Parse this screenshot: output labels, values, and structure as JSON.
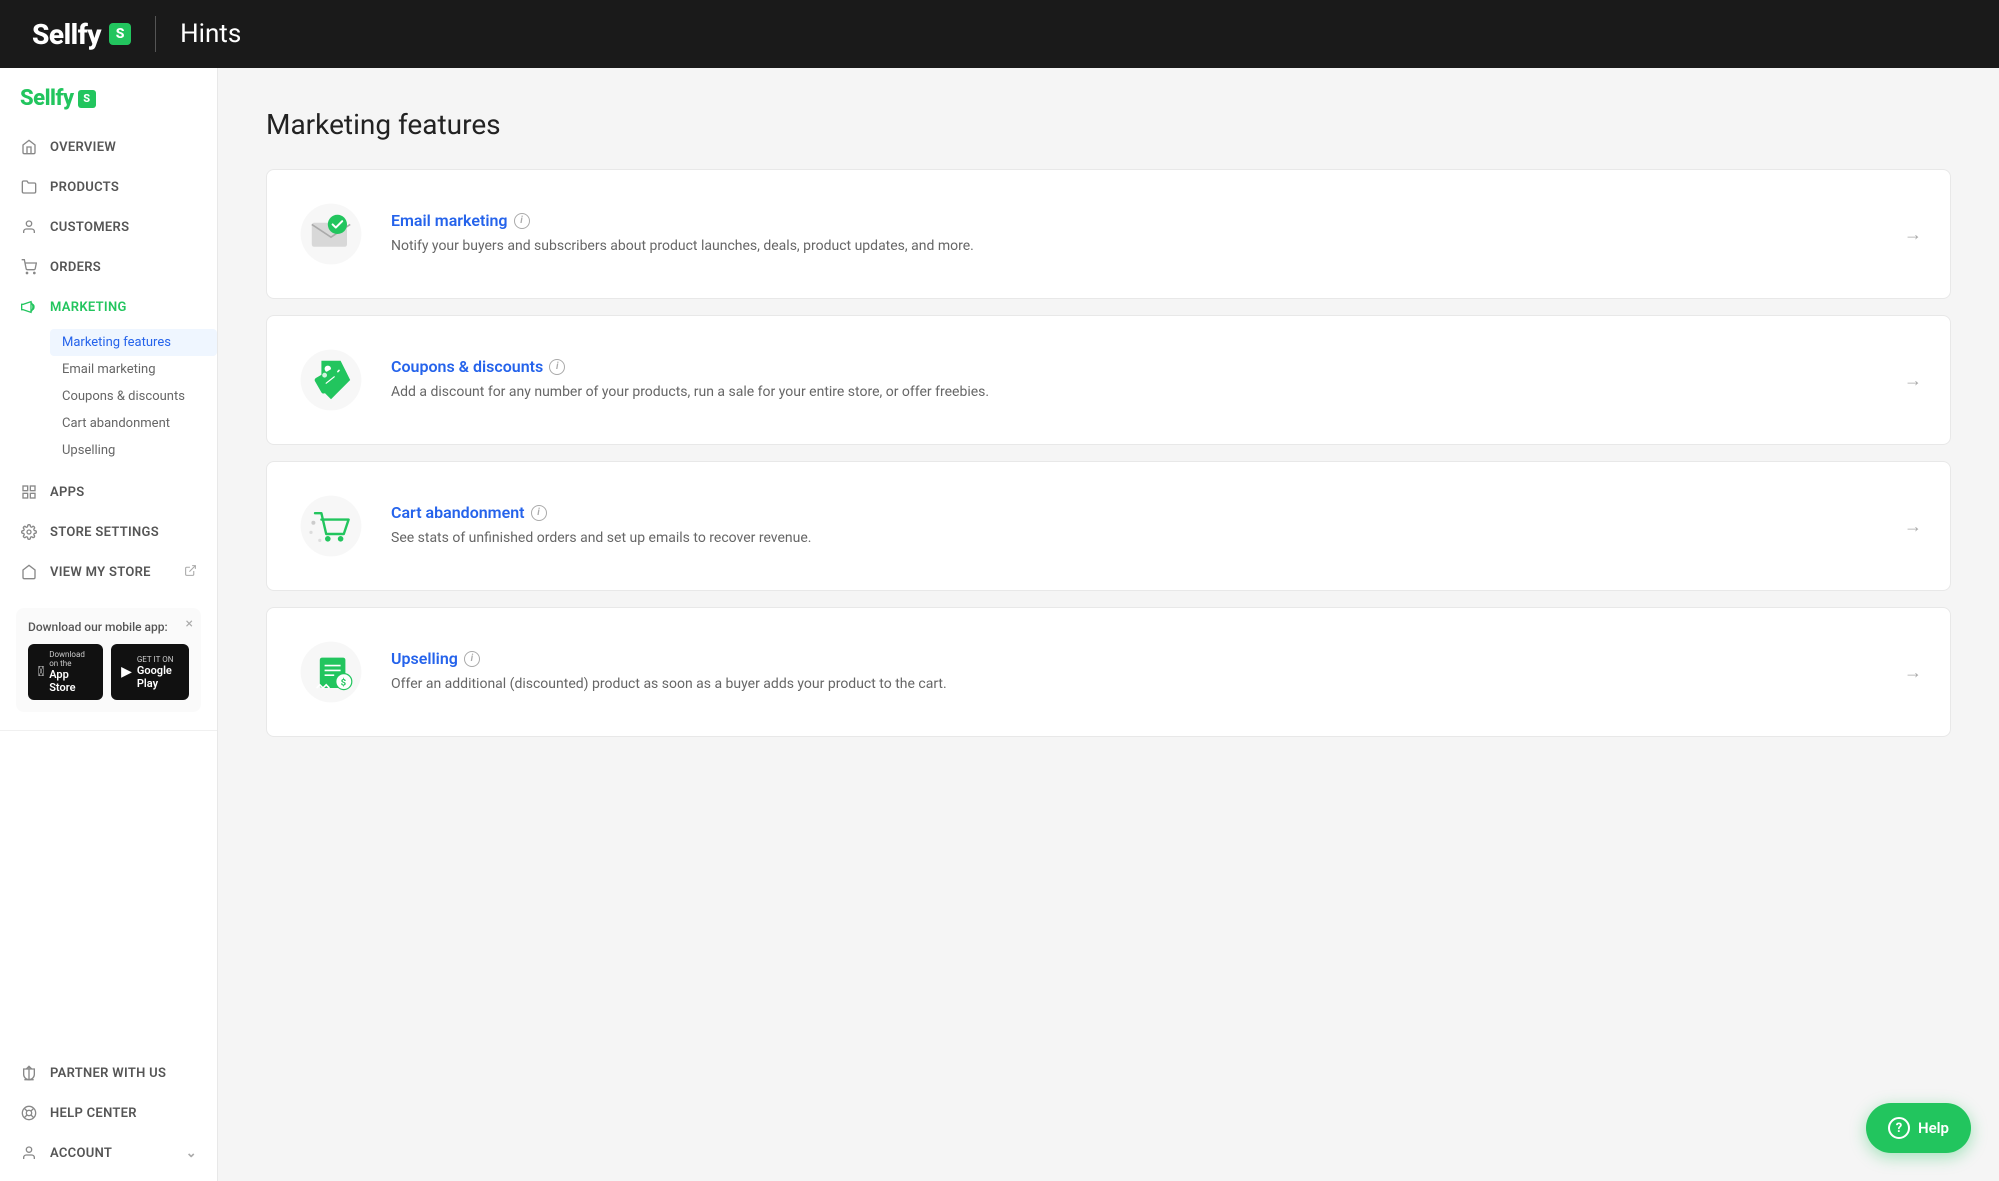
{
  "header": {
    "logo_text": "Sellfy",
    "logo_badge": "S",
    "divider": true,
    "title": "Hints"
  },
  "sidebar": {
    "brand_text": "Sellfy",
    "brand_badge": "S",
    "nav_items": [
      {
        "id": "overview",
        "label": "Overview",
        "icon": "home"
      },
      {
        "id": "products",
        "label": "Products",
        "icon": "folder"
      },
      {
        "id": "customers",
        "label": "Customers",
        "icon": "person"
      },
      {
        "id": "orders",
        "label": "Orders",
        "icon": "cart"
      },
      {
        "id": "marketing",
        "label": "Marketing",
        "icon": "megaphone",
        "active": true
      },
      {
        "id": "apps",
        "label": "Apps",
        "icon": "apps"
      },
      {
        "id": "store-settings",
        "label": "Store Settings",
        "icon": "gear"
      },
      {
        "id": "view-my-store",
        "label": "View My Store",
        "icon": "external"
      }
    ],
    "marketing_sub": [
      {
        "id": "marketing-features",
        "label": "Marketing features",
        "active": true
      },
      {
        "id": "email-marketing",
        "label": "Email marketing"
      },
      {
        "id": "coupons-discounts",
        "label": "Coupons & discounts"
      },
      {
        "id": "cart-abandonment",
        "label": "Cart abandonment"
      },
      {
        "id": "upselling",
        "label": "Upselling"
      }
    ],
    "mobile_app": {
      "title": "Download our mobile app:",
      "app_store_top": "Download on the",
      "app_store_name": "App Store",
      "google_play_top": "GET IT ON",
      "google_play_name": "Google Play"
    },
    "bottom_items": [
      {
        "id": "partner",
        "label": "Partner With Us",
        "icon": "trophy"
      },
      {
        "id": "help-center",
        "label": "Help Center",
        "icon": "lifering"
      },
      {
        "id": "account",
        "label": "Account",
        "icon": "person"
      }
    ]
  },
  "main": {
    "page_title": "Marketing features",
    "features": [
      {
        "id": "email-marketing",
        "title": "Email marketing",
        "description": "Notify your buyers and subscribers about product launches, deals, product updates, and more.",
        "has_info": true
      },
      {
        "id": "coupons-discounts",
        "title": "Coupons & discounts",
        "description": "Add a discount for any number of your products, run a sale for your entire store, or offer freebies.",
        "has_info": true
      },
      {
        "id": "cart-abandonment",
        "title": "Cart abandonment",
        "description": "See stats of unfinished orders and set up emails to recover revenue.",
        "has_info": true
      },
      {
        "id": "upselling",
        "title": "Upselling",
        "description": "Offer an additional (discounted) product as soon as a buyer adds your product to the cart.",
        "has_info": true
      }
    ]
  },
  "help_button": {
    "label": "Help"
  },
  "colors": {
    "brand_green": "#22c55e",
    "link_blue": "#2563eb",
    "header_bg": "#1a1a1a"
  }
}
